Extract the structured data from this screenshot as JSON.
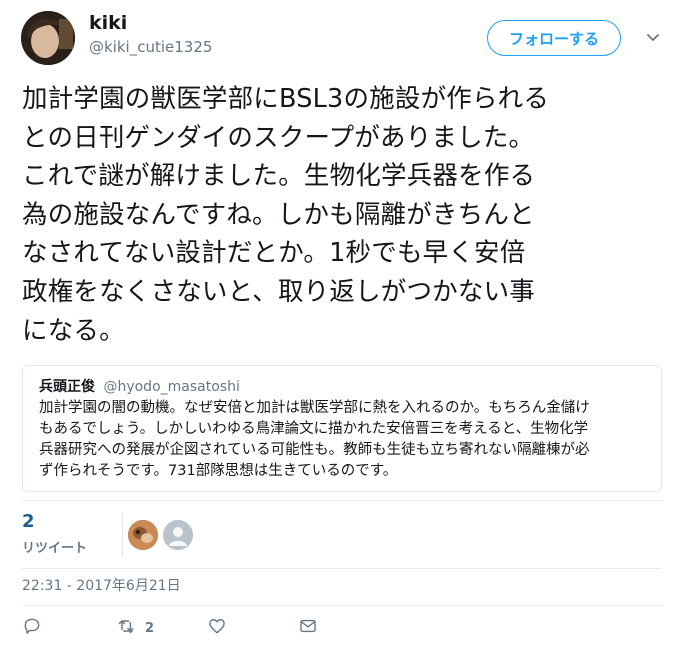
{
  "user": {
    "display_name": "kiki",
    "handle": "@kiki_cutie1325"
  },
  "follow_button": {
    "label": "フォローする"
  },
  "tweet": {
    "text": "加計学園の獣医学部にBSL3の施設が作られる\nとの日刊ゲンダイのスクープがありました。\nこれで謎が解けました。生物化学兵器を作る\n為の施設なんですね。しかも隔離がきちんと\nなされてない設計だとか。1秒でも早く安倍\n政権をなくさないと、取り返しがつかない事\nになる。"
  },
  "quoted_tweet": {
    "name": "兵頭正俊",
    "handle": "@hyodo_masatoshi",
    "text": "加計学園の闇の動機。なぜ安倍と加計は獣医学部に熱を入れるのか。もちろん金儲け\nもあるでしょう。しかしいわゆる鳥津論文に描かれた安倍晋三を考えると、生物化学\n兵器研究への発展が企図されている可能性も。教師も生徒も立ち寄れない隔離棟が必\nず作られそうです。731部隊思想は生きているのです。"
  },
  "stats": {
    "retweet_count": "2",
    "retweet_label": "リツイート"
  },
  "timestamp": "22:31 - 2017年6月21日",
  "actions": {
    "reply_icon": "reply-icon",
    "retweet_icon": "retweet-icon",
    "retweet_count": "2",
    "like_icon": "heart-icon",
    "dm_icon": "envelope-icon"
  },
  "colors": {
    "accent": "#1da1f2",
    "muted": "#657786",
    "text": "#14171a",
    "border": "#e1e8ed"
  }
}
